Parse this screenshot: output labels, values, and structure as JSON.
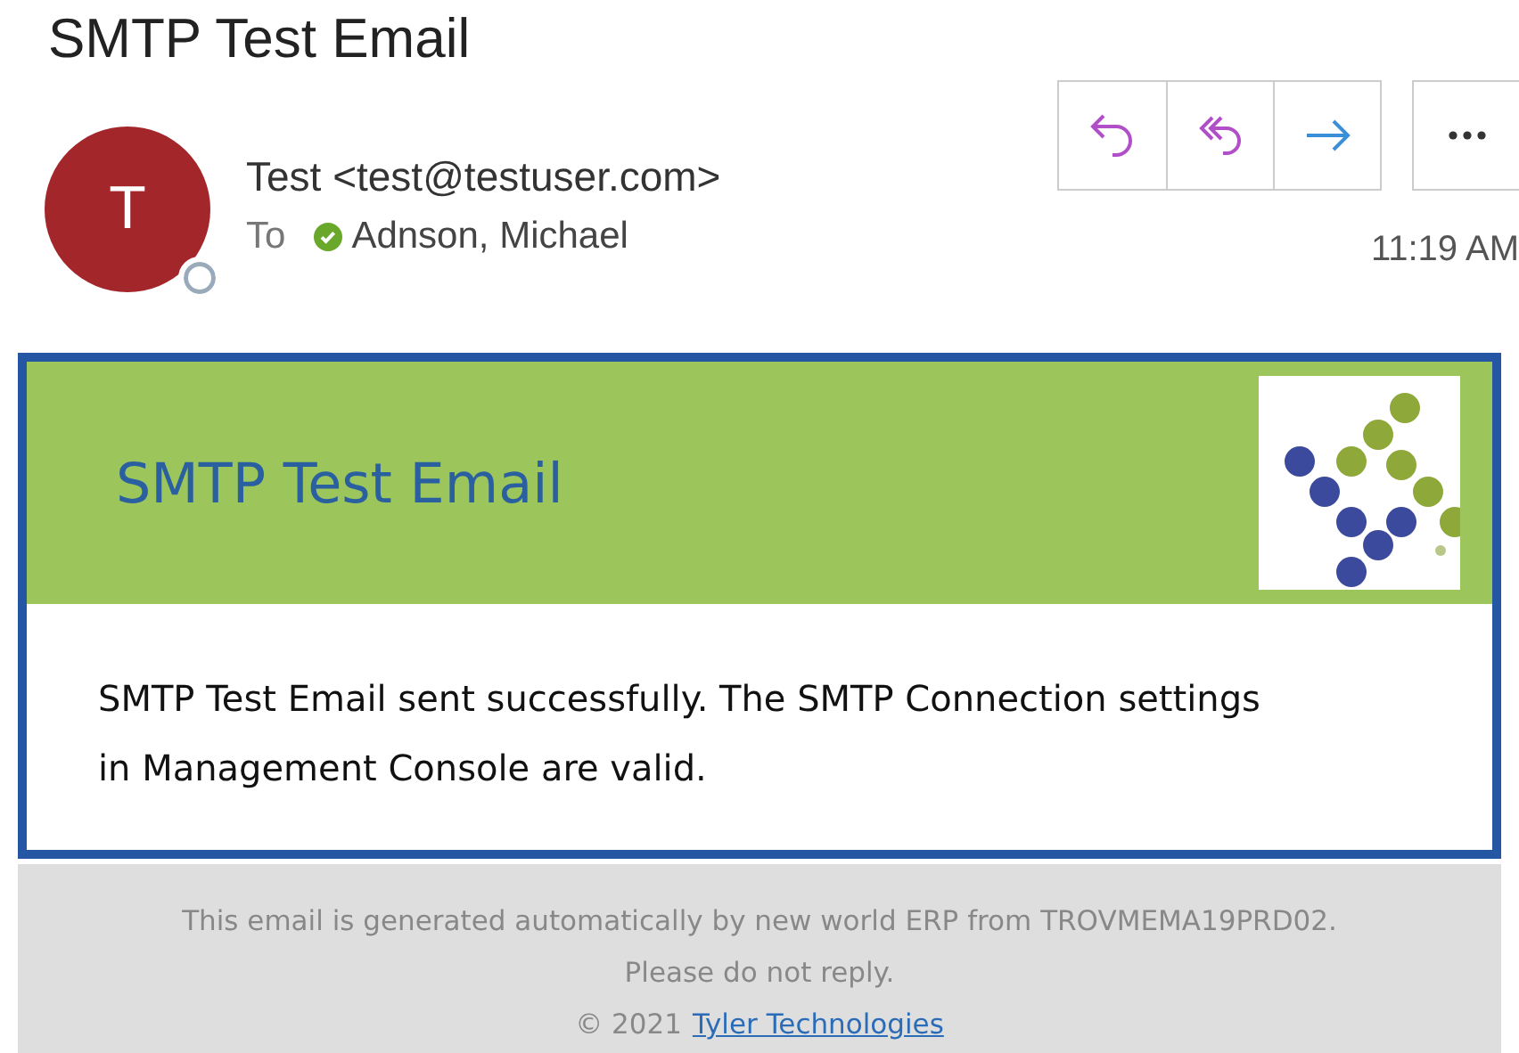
{
  "subject": "SMTP Test Email",
  "sender": {
    "initial": "T",
    "name": "Test <test@testuser.com>"
  },
  "recipients": {
    "label": "To",
    "names": [
      {
        "name": "Adnson, Michael",
        "verified": true
      }
    ]
  },
  "time": "11:19 AM",
  "actions": [
    {
      "kind": "reply"
    },
    {
      "kind": "reply-all"
    },
    {
      "kind": "forward"
    },
    {
      "kind": "more"
    }
  ],
  "banner": {
    "title": "SMTP Test Email"
  },
  "body": "SMTP Test Email sent successfully. The SMTP Connection settings in Management Console are valid.",
  "footer": {
    "notice": "This email is generated automatically by new world ERP from TROVMEMA19PRD02.",
    "request": "Please do not reply.",
    "copyright": "© 2021",
    "link": "Tyler Technologies"
  }
}
